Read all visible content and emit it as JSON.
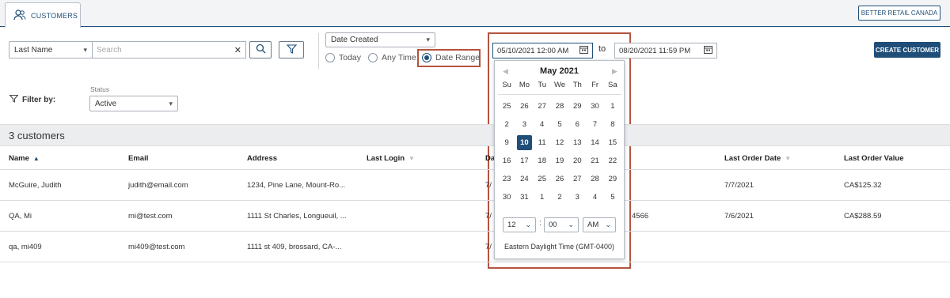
{
  "tabs": [
    {
      "label": "CUSTOMERS"
    }
  ],
  "store_button": "BETTER RETAIL CANADA",
  "search": {
    "field_select": "Last Name",
    "placeholder": "Search",
    "clear": "✕"
  },
  "date_filter": {
    "select": "Date Created",
    "options": [
      "Today",
      "Any Time",
      "Date Range"
    ],
    "selected": "Date Range",
    "from": "05/10/2021 12:00 AM",
    "to_label": "to",
    "to": "08/20/2021 11:59 PM"
  },
  "create_button": "CREATE CUSTOMER",
  "filter": {
    "label": "Filter by:",
    "status_label": "Status",
    "status_value": "Active"
  },
  "count_text": "3 customers",
  "columns": [
    "Name",
    "Email",
    "Address",
    "Last Login",
    "Da",
    "Last Order Date",
    "Last Order Value"
  ],
  "rows": [
    {
      "name": "McGuire, Judith",
      "email": "judith@email.com",
      "address": "1234, Pine Lane, Mount-Ro...",
      "da": "7/",
      "phone": "",
      "last_order_date": "7/7/2021",
      "last_order_value": "CA$125.32"
    },
    {
      "name": "QA, Mi",
      "email": "mi@test.com",
      "address": "1111 St Charles, Longueuil, ...",
      "da": "7/",
      "phone": "4566",
      "last_order_date": "7/6/2021",
      "last_order_value": "CA$288.59"
    },
    {
      "name": "qa, mi409",
      "email": "mi409@test.com",
      "address": "1111 st 409, brossard, CA-...",
      "da": "7/",
      "phone": "",
      "last_order_date": "",
      "last_order_value": ""
    }
  ],
  "calendar": {
    "month_title": "May 2021",
    "weekdays": [
      "Su",
      "Mo",
      "Tu",
      "We",
      "Th",
      "Fr",
      "Sa"
    ],
    "days": [
      "25",
      "26",
      "27",
      "28",
      "29",
      "30",
      "1",
      "2",
      "3",
      "4",
      "5",
      "6",
      "7",
      "8",
      "9",
      "10",
      "11",
      "12",
      "13",
      "14",
      "15",
      "16",
      "17",
      "18",
      "19",
      "20",
      "21",
      "22",
      "23",
      "24",
      "25",
      "26",
      "27",
      "28",
      "29",
      "30",
      "31",
      "1",
      "2",
      "3",
      "4",
      "5"
    ],
    "selected_day": "10",
    "hour": "12",
    "sep": ":",
    "minute": "00",
    "ampm": "AM",
    "timezone": "Eastern Daylight Time (GMT-0400)"
  },
  "colors": {
    "accent": "#1f4e79",
    "highlight": "#b5533f"
  }
}
